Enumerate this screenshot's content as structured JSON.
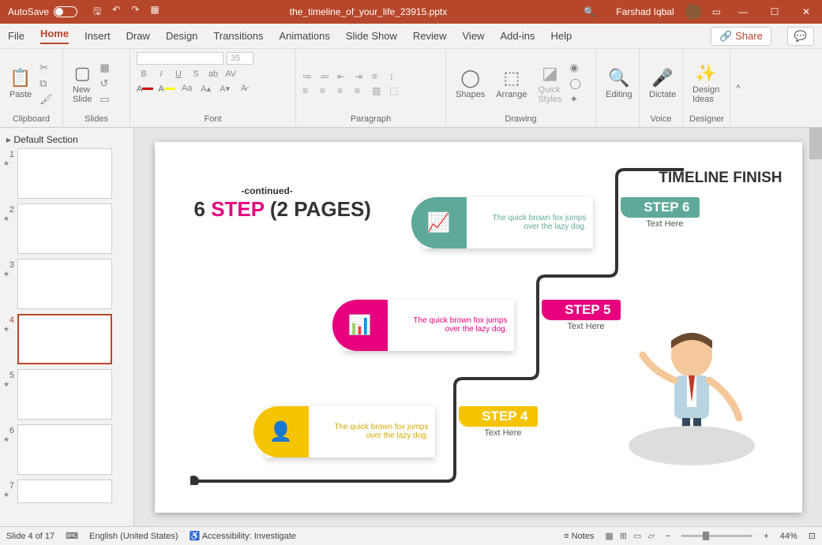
{
  "titlebar": {
    "autosave": "AutoSave",
    "filename": "the_timeline_of_your_life_23915.pptx",
    "username": "Farshad Iqbal"
  },
  "tabs": {
    "file": "File",
    "home": "Home",
    "insert": "Insert",
    "draw": "Draw",
    "design": "Design",
    "transitions": "Transitions",
    "animations": "Animations",
    "slideshow": "Slide Show",
    "review": "Review",
    "view": "View",
    "addins": "Add-ins",
    "help": "Help",
    "share": "Share"
  },
  "ribbon": {
    "paste": "Paste",
    "clipboard": "Clipboard",
    "newslide": "New\nSlide",
    "slides": "Slides",
    "font": "Font",
    "paragraph": "Paragraph",
    "shapes": "Shapes",
    "arrange": "Arrange",
    "quickstyles": "Quick\nStyles",
    "drawing": "Drawing",
    "editing": "Editing",
    "dictate": "Dictate",
    "voice": "Voice",
    "designideas": "Design\nIdeas",
    "designer": "Designer",
    "fontsize": "35"
  },
  "thumbs": {
    "section": "Default Section",
    "nums": [
      "1",
      "2",
      "3",
      "4",
      "5",
      "6",
      "7"
    ]
  },
  "slide": {
    "continued": "-continued-",
    "heading_pre": "6 ",
    "heading_pink": "STEP ",
    "heading_post": "(2 PAGES)",
    "finish": "TIMELINE FINISH",
    "step6": "STEP 6",
    "step5": "STEP 5",
    "step4": "STEP 4",
    "texthere": "Text Here",
    "lorem": "The quick brown fox jumps over the lazy dog."
  },
  "status": {
    "slidecount": "Slide 4 of 17",
    "lang": "English (United States)",
    "access": "Accessibility: Investigate",
    "notes": "Notes",
    "zoom": "44%"
  }
}
